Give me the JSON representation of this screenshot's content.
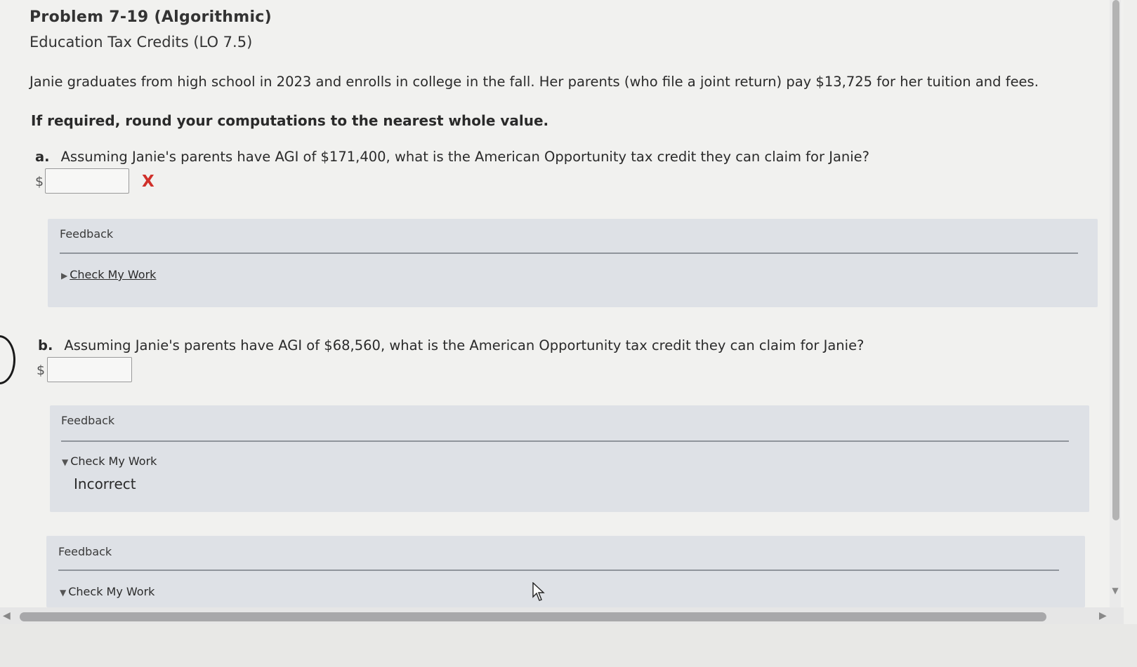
{
  "problem": {
    "title": "Problem 7-19 (Algorithmic)",
    "subtitle": "Education Tax Credits (LO 7.5)",
    "prompt": "Janie graduates from high school in 2023 and enrolls in college in the fall. Her parents (who file a joint return) pay $13,725 for her tuition and fees.",
    "instruction": "If required, round your computations to the nearest whole value."
  },
  "questions": [
    {
      "letter": "a.",
      "text": "Assuming Janie's parents have AGI of $171,400, what is the American Opportunity tax credit they can claim for Janie?",
      "currency": "$",
      "answer_value": "",
      "status_mark": "X",
      "feedback_label": "Feedback",
      "check_label": "Check My Work",
      "collapse_icon": "triangle-right-icon"
    },
    {
      "letter": "b.",
      "text": "Assuming Janie's parents have AGI of $68,560, what is the American Opportunity tax credit they can claim for Janie?",
      "currency": "$",
      "answer_value": "",
      "feedback_label": "Feedback",
      "check_label": "Check My Work",
      "collapse_icon": "triangle-down-icon",
      "result": "Incorrect"
    }
  ],
  "extra_feedback": {
    "feedback_label": "Feedback",
    "check_label": "Check My Work",
    "collapse_icon": "triangle-down-icon"
  },
  "colors": {
    "error": "#d0302a",
    "feedback_bg": "#dee1e6"
  }
}
